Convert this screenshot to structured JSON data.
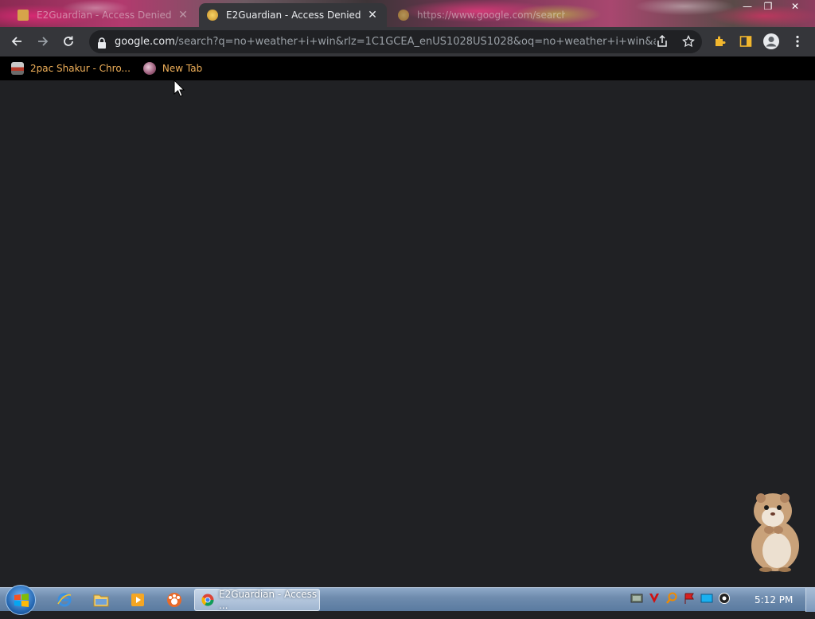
{
  "tabs": [
    {
      "title": "E2Guardian - Access Denied",
      "close": "✕"
    },
    {
      "title": "E2Guardian - Access Denied",
      "close": "✕"
    },
    {
      "title": "https://www.google.com/search"
    }
  ],
  "window_controls": {
    "minimize": "—",
    "maximize": "❐",
    "close": "✕"
  },
  "omnibox": {
    "host": "google.com",
    "path": "/search?q=no+weather+i+win&rlz=1C1GCEA_enUS1028US1028&oq=no+weather+i+win&aqs..."
  },
  "bookmarks": [
    {
      "label": "2pac Shakur - Chro...",
      "icon": "bookmark-favicon-icon"
    },
    {
      "label": "New Tab",
      "icon": "new-tab-favicon-icon"
    }
  ],
  "taskbar": {
    "active_task_label": "E2Guardian - Access ...",
    "clock": "5:12 PM"
  },
  "colors": {
    "page_bg": "#202124",
    "toolbar_bg": "#35363a",
    "bookmark_text": "#f0b05a",
    "taskbar": "#6f8cae"
  }
}
